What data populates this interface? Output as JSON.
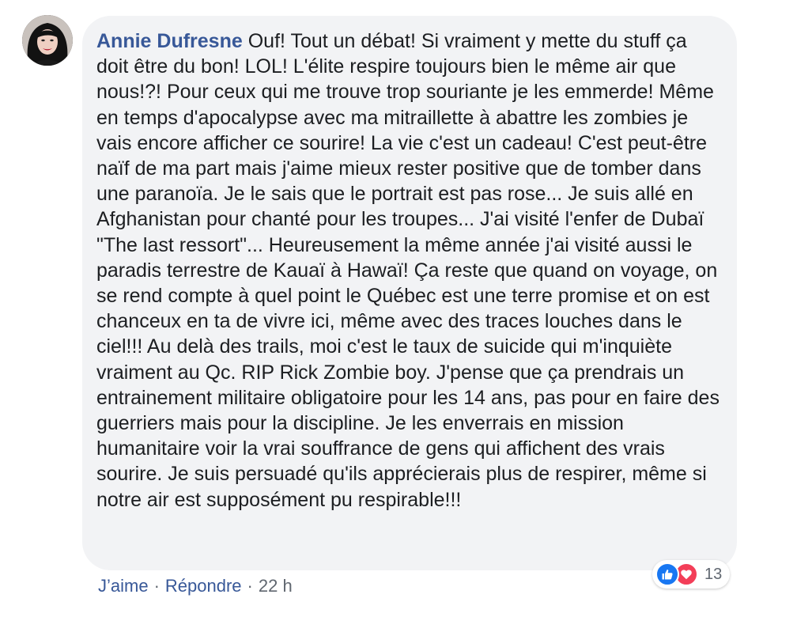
{
  "comment": {
    "author": "Annie Dufresne",
    "text": "Ouf! Tout un débat! Si vraiment y mette du stuff ça doit être du bon! LOL! L'élite respire toujours bien le même air que nous!?! Pour ceux qui me trouve trop souriante je les emmerde! Même en temps d'apocalypse avec ma mitraillette à abattre les zombies je vais encore afficher ce sourire! La vie c'est un cadeau! C'est peut-être naïf de ma part mais j'aime mieux rester positive que de tomber dans une paranoïa. Je le sais que le portrait est pas rose... Je suis allé en Afghanistan pour chanté pour les troupes... J'ai visité l'enfer de Dubaï \"The last ressort\"... Heureusement la même année j'ai visité aussi le paradis terrestre de Kauaï à Hawaï! Ça reste que quand on voyage, on se rend compte à quel point le Québec est une terre promise et on est chanceux en ta de vivre ici, même avec des traces louches dans le ciel!!! Au delà des trails, moi c'est le taux de suicide qui m'inquiète vraiment au Qc. RIP Rick Zombie boy. J'pense que ça prendrais un entrainement militaire obligatoire pour les 14 ans, pas pour en faire des guerriers mais pour la discipline. Je les enverrais en mission humanitaire voir la vrai souffrance de gens qui affichent des vrais sourire. Je suis persuadé qu'ils apprécierais plus de respirer, même si notre air est supposément pu respirable!!!"
  },
  "reactions": {
    "icons": [
      "like-icon",
      "love-icon"
    ],
    "count": "13"
  },
  "actions": {
    "like_label": "J’aime",
    "separator": "·",
    "reply_label": "Répondre",
    "timestamp": "22 h"
  },
  "colors": {
    "author_link": "#385898",
    "bubble_bg": "#f2f3f5",
    "text": "#1c1e21",
    "muted": "#606770",
    "like_blue": "#1877f2",
    "love_red": "#f33e58"
  }
}
